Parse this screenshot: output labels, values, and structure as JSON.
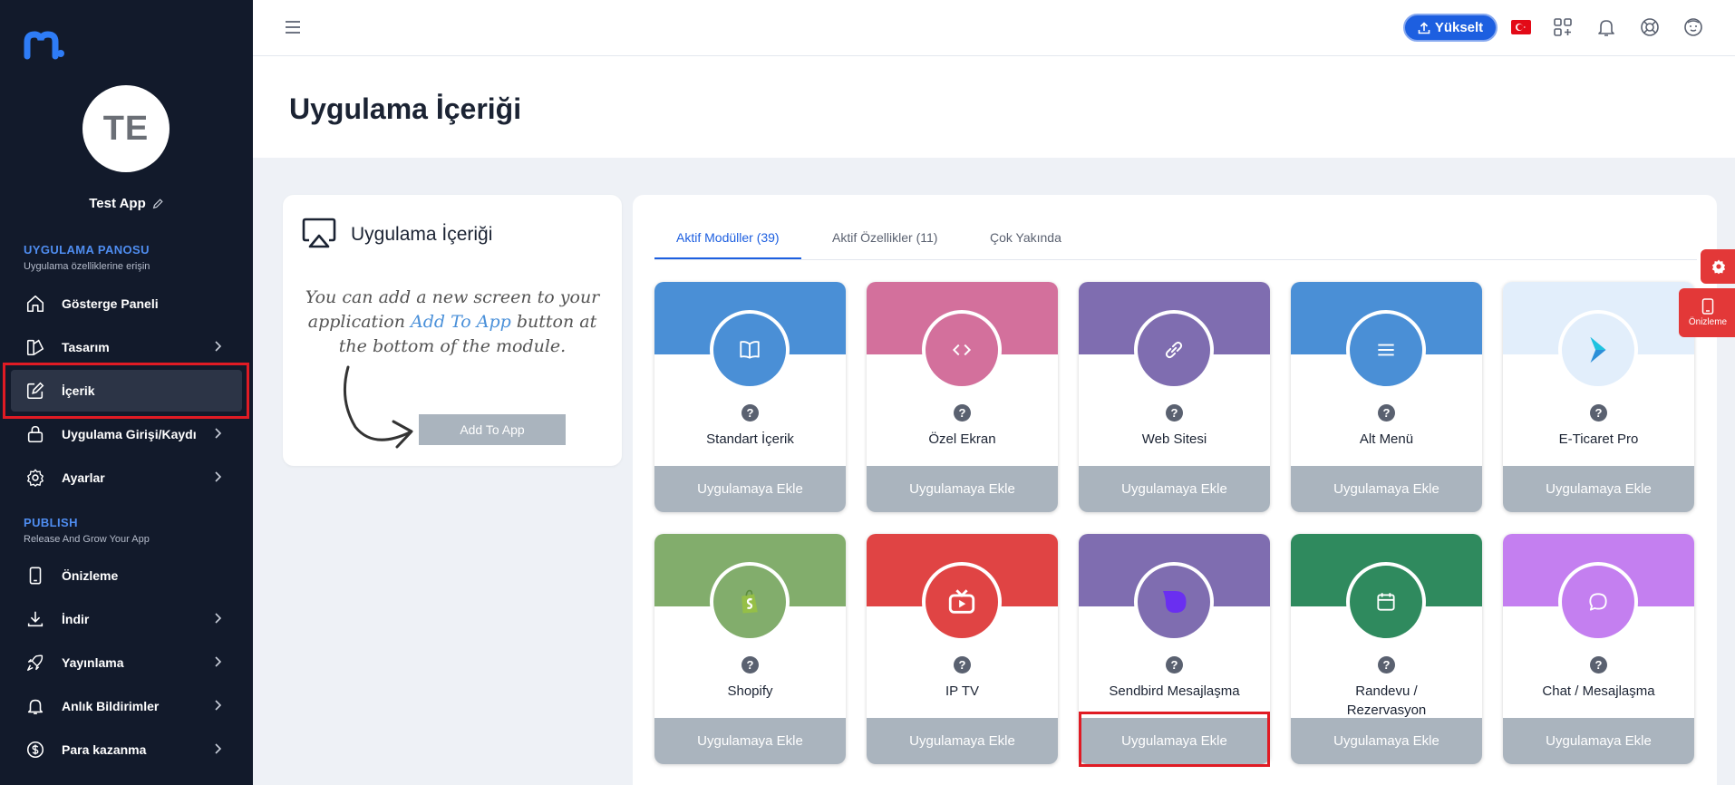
{
  "app": {
    "avatar_initials": "TE",
    "name": "Test App"
  },
  "sidebar": {
    "section1_title": "UYGULAMA PANOSU",
    "section1_sub": "Uygulama özelliklerine erişin",
    "items1": [
      {
        "label": "Gösterge Paneli",
        "icon": "home-icon"
      },
      {
        "label": "Tasarım",
        "icon": "design-icon"
      },
      {
        "label": "İçerik",
        "icon": "edit-icon"
      },
      {
        "label": "Uygulama Girişi/Kaydı",
        "icon": "lock-icon"
      },
      {
        "label": "Ayarlar",
        "icon": "gear-icon"
      }
    ],
    "section2_title": "PUBLISH",
    "section2_sub": "Release And Grow Your App",
    "items2": [
      {
        "label": "Önizleme",
        "icon": "phone-icon"
      },
      {
        "label": "İndir",
        "icon": "download-icon"
      },
      {
        "label": "Yayınlama",
        "icon": "rocket-icon"
      },
      {
        "label": "Anlık Bildirimler",
        "icon": "bell-icon"
      },
      {
        "label": "Para kazanma",
        "icon": "dollar-icon"
      }
    ]
  },
  "topbar": {
    "upgrade_label": "Yükselt"
  },
  "page": {
    "title": "Uygulama İçeriği"
  },
  "info": {
    "title": "Uygulama İçeriği",
    "text_pre": "You can add a new screen to your application",
    "text_hl": "Add To App",
    "text_post": "button at the bottom of the module.",
    "button": "Add To App"
  },
  "tabs": [
    {
      "label": "Aktif Modüller (39)"
    },
    {
      "label": "Aktif Özellikler (11)"
    },
    {
      "label": "Çok Yakında"
    }
  ],
  "modules": [
    {
      "name": "Standart İçerik",
      "button": "Uygulamaya Ekle",
      "color": "#4a8fd6",
      "icon": "book-icon"
    },
    {
      "name": "Özel Ekran",
      "button": "Uygulamaya Ekle",
      "color": "#d3709c",
      "icon": "code-icon"
    },
    {
      "name": "Web Sitesi",
      "button": "Uygulamaya Ekle",
      "color": "#7f6db0",
      "icon": "link-icon"
    },
    {
      "name": "Alt Menü",
      "button": "Uygulamaya Ekle",
      "color": "#4a8fd6",
      "icon": "menu-icon"
    },
    {
      "name": "E-Ticaret Pro",
      "button": "Uygulamaya Ekle",
      "color": "#e2eefb",
      "icon": "chevron-logo-icon"
    },
    {
      "name": "Shopify",
      "button": "Uygulamaya Ekle",
      "color": "#82ad6c",
      "icon": "shopify-bag-icon"
    },
    {
      "name": "IP TV",
      "button": "Uygulamaya Ekle",
      "color": "#e04444",
      "icon": "tv-icon"
    },
    {
      "name": "Sendbird Mesajlaşma",
      "button": "Uygulamaya Ekle",
      "color": "#7f6db0",
      "icon": "sendbird-icon"
    },
    {
      "name": "Randevu / Rezervasyon",
      "button": "Uygulamaya Ekle",
      "color": "#2f8a5e",
      "icon": "calendar-icon"
    },
    {
      "name": "Chat / Mesajlaşma",
      "button": "Uygulamaya Ekle",
      "color": "#c47ff0",
      "icon": "chat-icon"
    }
  ],
  "floating": {
    "preview_label": "Önizleme"
  }
}
